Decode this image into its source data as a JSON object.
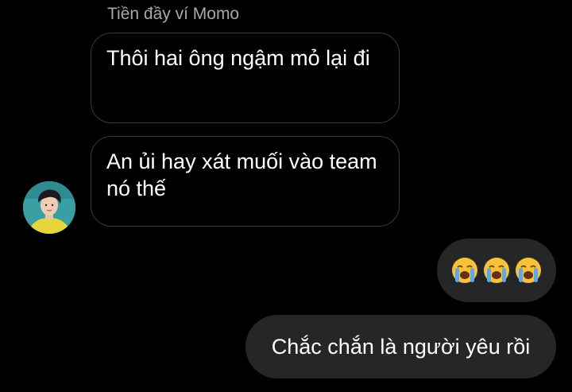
{
  "conversation": {
    "sender_name": "Tiền đầy ví Momo",
    "messages": [
      {
        "from": "other",
        "text": "Thôi hai ông ngậm mỏ lại đi"
      },
      {
        "from": "other",
        "text": "An ủi hay xát muối vào team nó thế"
      },
      {
        "from": "me",
        "emoji": [
          "loudly-crying-face",
          "loudly-crying-face",
          "loudly-crying-face"
        ]
      },
      {
        "from": "me",
        "text": "Chắc chắn là người yêu rồi"
      }
    ]
  },
  "colors": {
    "background": "#000000",
    "incoming_border": "#3a3a3a",
    "outgoing_bubble": "#262626",
    "sender_name": "#a8a8a8",
    "text": "#ffffff"
  }
}
